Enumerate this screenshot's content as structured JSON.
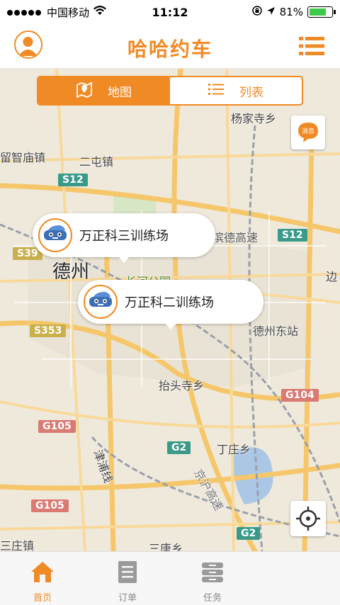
{
  "status_bar": {
    "carrier": "中国移动",
    "time": "11:12",
    "battery": "81%",
    "battery_level": 0.81
  },
  "header": {
    "title": "哈哈约车",
    "avatar_icon": "user-avatar-icon",
    "menu_icon": "list-menu-icon"
  },
  "view_toggle": {
    "map_label": "地图",
    "list_label": "列表",
    "selected": "map"
  },
  "map": {
    "labels": {
      "yangjiasi": "杨家寺乡",
      "liuzhimiao": "留智庙镇",
      "ertun": "二屯镇",
      "dezhou": "德州",
      "changhe_park": "长河公园",
      "bindegaosu": "滨德高速",
      "dezhou_east": "德州东站",
      "taitousi": "抬头寺乡",
      "dingzhuang": "丁庄乡",
      "jinpu": "津浦线",
      "jinghu": "京沪高速",
      "sanzhuang": "三庄镇",
      "santang": "三唐乡",
      "bian": "边"
    },
    "shields": {
      "s12a": "S12",
      "s12b": "S12",
      "s39": "S39",
      "s353": "S353",
      "g104": "G104",
      "g105a": "G105",
      "g105b": "G105",
      "g2a": "G2",
      "g2b": "G2"
    },
    "markers": [
      {
        "name": "万正科三训练场"
      },
      {
        "name": "万正科二训练场"
      }
    ],
    "message_button": "消息",
    "locate_icon": "crosshair-locate-icon"
  },
  "tabbar": {
    "tabs": [
      {
        "label": "首页",
        "icon": "home-icon",
        "active": true
      },
      {
        "label": "订单",
        "icon": "order-icon",
        "active": false
      },
      {
        "label": "任务",
        "icon": "task-icon",
        "active": false
      }
    ]
  },
  "colors": {
    "accent": "#f08a24"
  }
}
